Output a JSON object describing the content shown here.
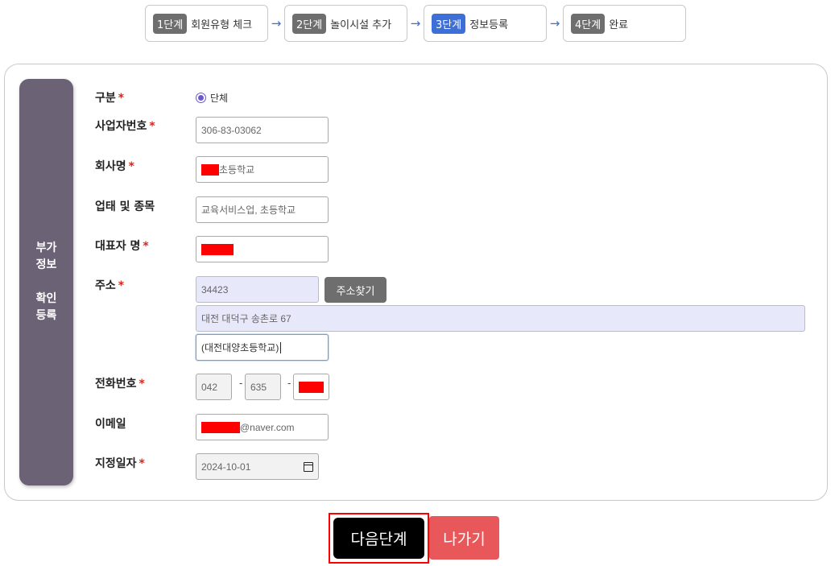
{
  "steps": [
    {
      "num": "1단계",
      "label": "회원유형 체크"
    },
    {
      "num": "2단계",
      "label": "놀이시설 추가"
    },
    {
      "num": "3단계",
      "label": "정보등록"
    },
    {
      "num": "4단계",
      "label": "완료"
    }
  ],
  "step_arrow": "→",
  "sidebar": {
    "line1": "부가",
    "line2": "정보",
    "line3": "확인",
    "line4": "등록"
  },
  "required_mark": "*",
  "form": {
    "type": {
      "label": "구분",
      "option": "단체"
    },
    "biz_no": {
      "label": "사업자번호",
      "value": "306-83-03062"
    },
    "company": {
      "label": "회사명",
      "value_suffix": "초등학교"
    },
    "business": {
      "label": "업태 및 종목",
      "value": "교육서비스업, 초등학교"
    },
    "ceo": {
      "label": "대표자 명"
    },
    "address": {
      "label": "주소",
      "zipcode": "34423",
      "search_button": "주소찾기",
      "addr1": "대전 대덕구 송촌로 67",
      "addr2": "(대전대양초등학교)"
    },
    "phone": {
      "label": "전화번호",
      "part1": "042",
      "part2": "635",
      "separator": "-"
    },
    "email": {
      "label": "이메일",
      "domain": "@naver.com"
    },
    "designation_date": {
      "label": "지정일자",
      "value": "2024-10-01"
    }
  },
  "buttons": {
    "next": "다음단계",
    "back": "나가기"
  },
  "colors": {
    "sidebar": "#6b6275",
    "active_step": "#3d6fd6",
    "required": "#d4281f",
    "back_button": "#e8585a",
    "redaction": "#ff0000"
  }
}
